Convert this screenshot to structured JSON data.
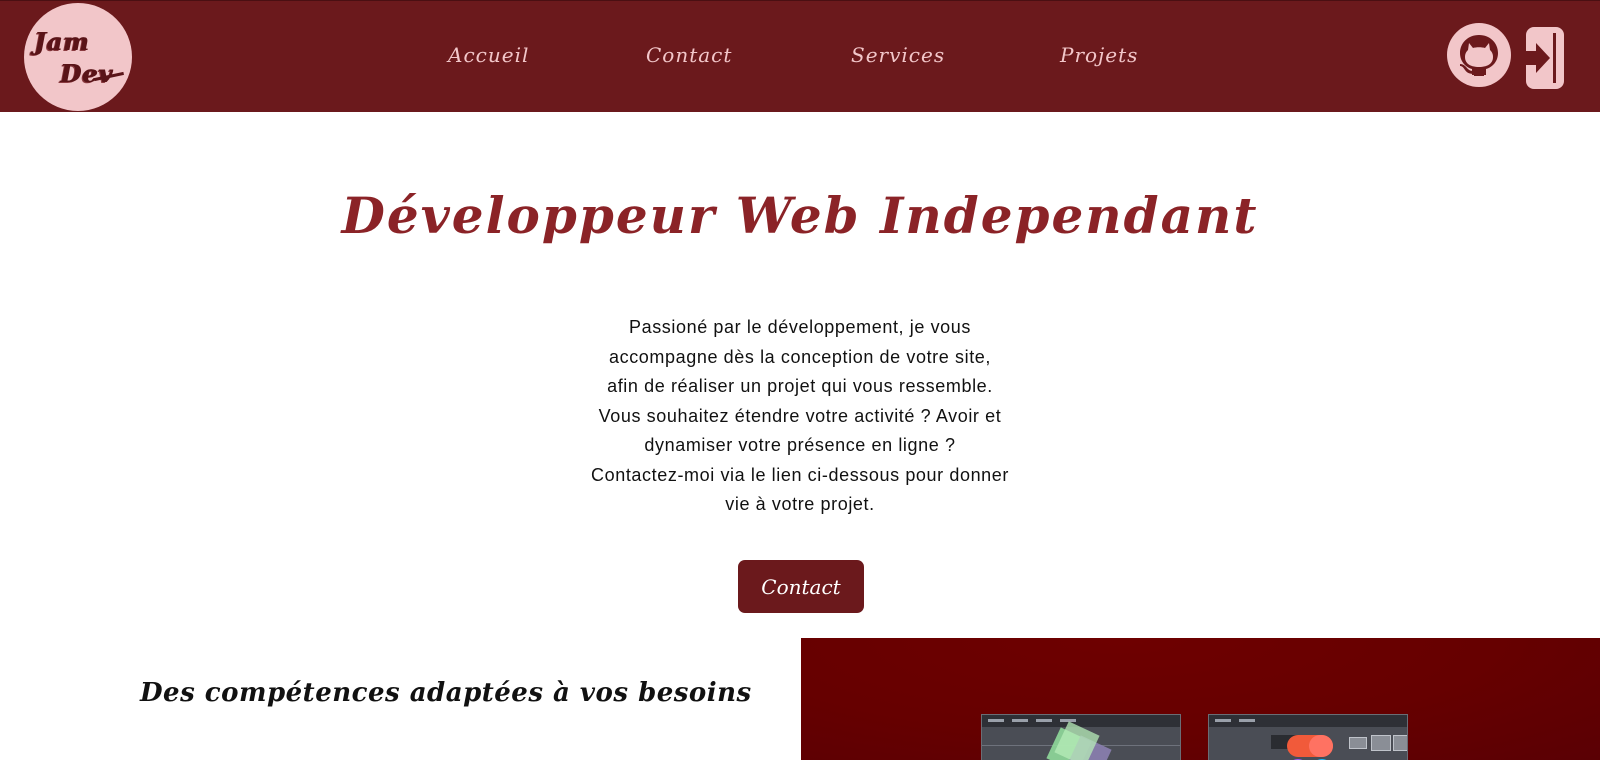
{
  "header": {
    "logo": {
      "line1": "Jam",
      "line2": "Dev"
    },
    "nav": [
      {
        "label": "Accueil"
      },
      {
        "label": "Contact"
      },
      {
        "label": "Services"
      },
      {
        "label": "Projets"
      }
    ],
    "icons": {
      "github": "github-icon",
      "login": "login-icon"
    }
  },
  "hero": {
    "title": "Développeur Web Independant",
    "paragraph_lines": [
      "Passioné par le développement, je vous",
      "accompagne dès la conception de votre site,",
      "afin de réaliser un projet qui vous ressemble.",
      "Vous souhaitez étendre votre activité ? Avoir et",
      "dynamiser votre présence en ligne ?",
      "Contactez-moi via le lien ci-dessous pour donner",
      "vie à votre projet."
    ],
    "cta_label": "Contact"
  },
  "skills": {
    "title": "Des compétences adaptées à vos besoins"
  },
  "colors": {
    "brand_dark": "#6b191c",
    "brand_light": "#f2c6c9",
    "title_red": "#8b2327",
    "panel_red": "#660000"
  }
}
